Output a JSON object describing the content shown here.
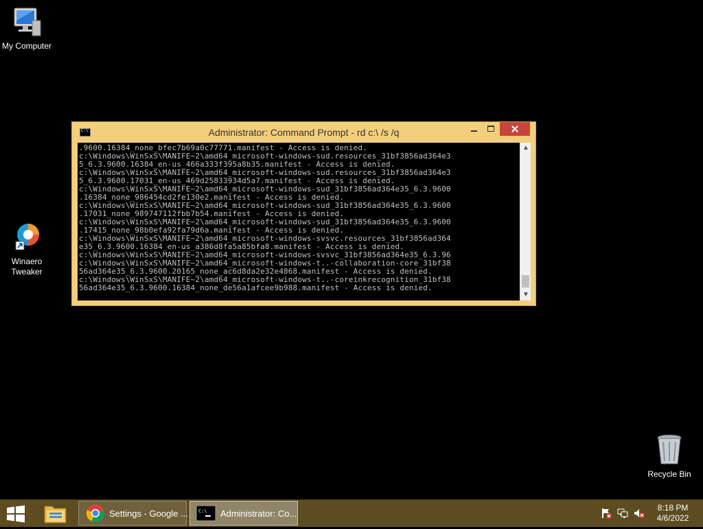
{
  "desktop": {
    "icons": [
      {
        "label": "My Computer"
      },
      {
        "label": "Winaero Tweaker"
      },
      {
        "label": "Recycle Bin"
      }
    ]
  },
  "window": {
    "title": "Administrator: Command Prompt - rd  c:\\ /s /q",
    "console_lines": [
      ".9600.16384_none_bfec7b69a0c77771.manifest - Access is denied.",
      "c:\\Windows\\WinSxS\\MANIFE~2\\amd64_microsoft-windows-sud.resources_31bf3856ad364e3",
      "5_6.3.9600.16384_en-us_466a333f395a8b35.manifest - Access is denied.",
      "c:\\Windows\\WinSxS\\MANIFE~2\\amd64_microsoft-windows-sud.resources_31bf3856ad364e3",
      "5_6.3.9600.17031_en-us_469d25833934d5a7.manifest - Access is denied.",
      "c:\\Windows\\WinSxS\\MANIFE~2\\amd64_microsoft-windows-sud_31bf3856ad364e35_6.3.9600",
      ".16384_none_986454cd2fe130e2.manifest - Access is denied.",
      "c:\\Windows\\WinSxS\\MANIFE~2\\amd64_microsoft-windows-sud_31bf3856ad364e35_6.3.9600",
      ".17031_none_989747112fbb7b54.manifest - Access is denied.",
      "c:\\Windows\\WinSxS\\MANIFE~2\\amd64_microsoft-windows-sud_31bf3856ad364e35_6.3.9600",
      ".17415_none_98b0efa92fa79d6a.manifest - Access is denied.",
      "c:\\Windows\\WinSxS\\MANIFE~2\\amd64_microsoft-windows-svsvc.resources_31bf3856ad364",
      "e35_6.3.9600.16384_en-us_a386d8fa5a85bfa8.manifest - Access is denied.",
      "c:\\Windows\\WinSxS\\MANIFE~2\\amd64_microsoft-windows-svsvc_31bf3856ad364e35_6.3.96",
      "c:\\Windows\\WinSxS\\MANIFE~2\\amd64_microsoft-windows-t..-collaboration-core_31bf38",
      "56ad364e35_6.3.9600.20165_none_ac6d8da2e32e4868.manifest - Access is denied.",
      "c:\\Windows\\WinSxS\\MANIFE~2\\amd64_microsoft-windows-t..-coreinkrecognition_31bf38",
      "56ad364e35_6.3.9600.16384_none_de56a1afcee9b988.manifest - Access is denied."
    ]
  },
  "taskbar": {
    "items": [
      {
        "label": "Settings - Google ..."
      },
      {
        "label": "Administrator: Co..."
      }
    ],
    "clock": {
      "time": "8:18 PM",
      "date": "4/6/2022"
    }
  },
  "icons": {
    "computer": "computer-icon",
    "tweaker": "winaero-tweaker-icon",
    "recycle": "recycle-bin-icon",
    "start": "windows-logo-icon",
    "explorer": "file-explorer-icon",
    "chrome": "chrome-icon",
    "cmd": "command-prompt-icon"
  },
  "colors": {
    "window_frame": "#f2cf7a",
    "close_button": "#c7453a",
    "taskbar": "#5c4c20",
    "console_text": "#c0c0c0"
  }
}
